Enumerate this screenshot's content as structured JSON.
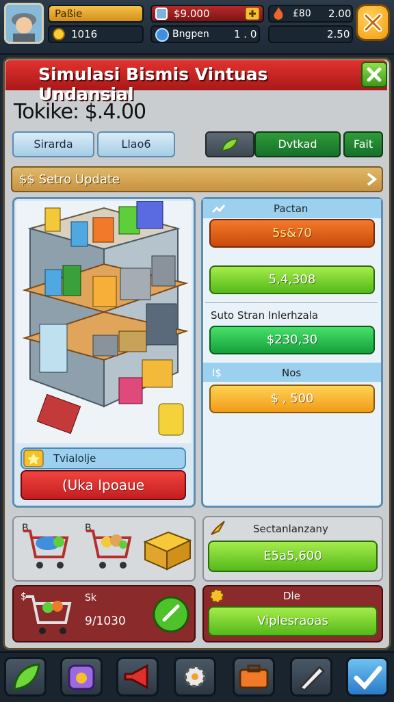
{
  "hud": {
    "player_name": "Paßie",
    "level_value": "1016",
    "cash_value": "$9.000",
    "fire_label": "£80",
    "fire_value": "2.00",
    "gem_label": "Bngpen",
    "gem_value": "1 . 0",
    "right_value": "2.50"
  },
  "panel": {
    "title": "Simulasi Bismis Vintuas Undansial",
    "total": "Tokike: $.4.00",
    "tabs": [
      "Sirarda",
      "Llao6"
    ],
    "action_tabs": [
      "Dvtkad",
      "Fait"
    ],
    "update_bar": "$$ Setro Update"
  },
  "shop": {
    "caption": "Tvialolje",
    "button": "(Uka Ipoaue"
  },
  "prices": {
    "section1_title": "Pactan",
    "section1_values": [
      "5s&70",
      "5,4,308"
    ],
    "section2_title": "Suto Stran Inlerhzala",
    "section2_value": "$230,30",
    "section3_prefix": "I$",
    "section3_title": "Nos",
    "section3_value": "$ , 500"
  },
  "cart_panel": {
    "label_a": "B",
    "label_b": "B"
  },
  "secondary": {
    "title": "Sectanlanzany",
    "value": "E5a5,600"
  },
  "cart2": {
    "label_a": "$",
    "label_b": "Sk",
    "value": "9/1030"
  },
  "dle": {
    "title": "Dle",
    "button": "Viplesraoas"
  },
  "colors": {
    "title_red": "#d8282a",
    "accent_gold": "#f2a11a",
    "accent_green": "#3bbf2a",
    "panel_bg": "#c9cdd0"
  },
  "icons": [
    "leaf-icon",
    "potion-icon",
    "megaphone-icon",
    "gear-icon",
    "toolbox-icon",
    "pen-icon",
    "check-icon"
  ]
}
